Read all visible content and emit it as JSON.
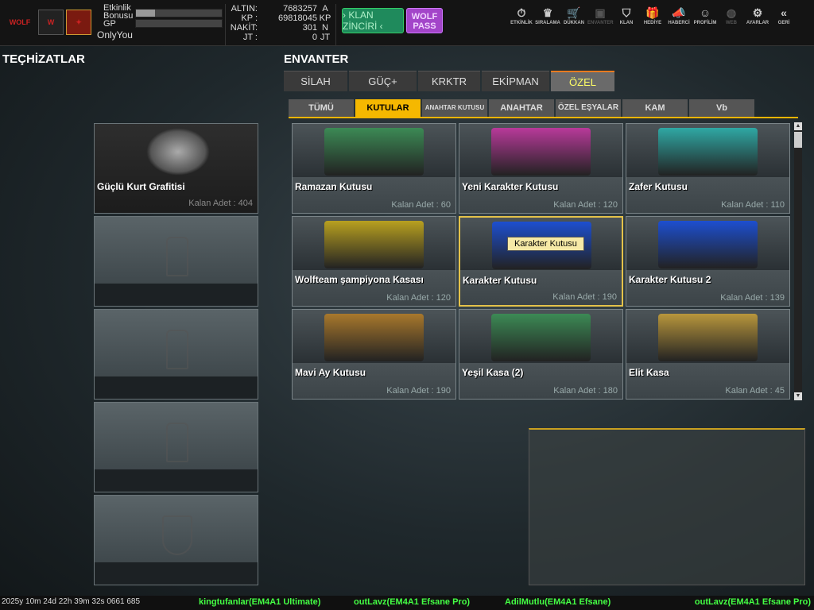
{
  "header": {
    "etkinlik_label": "Etkinlik Bonusu",
    "gp_label": "GP",
    "username": "OnlyYou",
    "etkinlik_progress": 0.22,
    "gp_progress": 0,
    "currency": [
      {
        "label": "ALTIN:",
        "value": "7683257",
        "unit": "A"
      },
      {
        "label": "KP :",
        "value": "69818045",
        "unit": "KP"
      },
      {
        "label": "NAKİT:",
        "value": "301",
        "unit": "N"
      },
      {
        "label": "JT :",
        "value": "0",
        "unit": "JT"
      }
    ],
    "klan_button": "› KLAN ZİNCİRİ ‹",
    "wolf_button": "WOLF PASS",
    "nav": [
      {
        "label": "ETKİNLİK",
        "icon": "⏱"
      },
      {
        "label": "SIRALAMA",
        "icon": "♛"
      },
      {
        "label": "DÜKKAN",
        "icon": "🛒"
      },
      {
        "label": "ENVANTER",
        "icon": "▣"
      },
      {
        "label": "KLAN",
        "icon": "⛉"
      },
      {
        "label": "HEDİYE",
        "icon": "🎁"
      },
      {
        "label": "HABERCİ",
        "icon": "📣"
      },
      {
        "label": "PROFİLİM",
        "icon": "☺"
      },
      {
        "label": "WEB",
        "icon": "◍"
      },
      {
        "label": "AYARLAR",
        "icon": "⚙"
      },
      {
        "label": "GERİ",
        "icon": "«"
      }
    ]
  },
  "equipment": {
    "title": "TEÇHİZATLAR",
    "slots": [
      {
        "name": "Güçlü Kurt Grafitisi",
        "count": "Kalan Adet : 404"
      }
    ]
  },
  "inventory": {
    "title": "ENVANTER",
    "tabs": [
      "SİLAH",
      "GÜÇ+",
      "KRKTR",
      "EKİPMAN",
      "ÖZEL"
    ],
    "subtabs": [
      "TÜMÜ",
      "KUTULAR",
      "ANAHTAR KUTUSU",
      "ANAHTAR",
      "ÖZEL EŞYALAR",
      "KAM",
      "Vb"
    ],
    "items": [
      {
        "name": "Ramazan Kutusu",
        "count": "Kalan Adet : 60",
        "color": "#3c8a55"
      },
      {
        "name": "Yeni Karakter Kutusu",
        "count": "Kalan Adet : 120",
        "color": "#b83a9a"
      },
      {
        "name": "Zafer Kutusu",
        "count": "Kalan Adet : 110",
        "color": "#2fa8a4"
      },
      {
        "name": "Wolfteam şampiyona Kasası",
        "count": "Kalan Adet : 120",
        "color": "#b8a020"
      },
      {
        "name": "Karakter Kutusu",
        "count": "Kalan Adet : 190",
        "color": "#1d4fd0"
      },
      {
        "name": "Karakter Kutusu 2",
        "count": "Kalan Adet : 139",
        "color": "#1d4fd0"
      },
      {
        "name": "Mavi Ay Kutusu",
        "count": "Kalan Adet : 190",
        "color": "#a8782c"
      },
      {
        "name": "Yeşil Kasa (2)",
        "count": "Kalan Adet : 180",
        "color": "#3c8a55"
      },
      {
        "name": "Elit Kasa",
        "count": "Kalan Adet : 45",
        "color": "#b8963c"
      }
    ],
    "tooltip": "Karakter Kutusu"
  },
  "ticker": {
    "timestamp": "2025y 10m 24d 22h 39m 32s 0661 685",
    "messages": [
      "kingtufanlar(EM4A1 Ultimate)",
      "outLavz(EM4A1 Efsane Pro)",
      "AdilMutlu(EM4A1 Efsane)",
      "outLavz(EM4A1 Efsane Pro)"
    ]
  }
}
